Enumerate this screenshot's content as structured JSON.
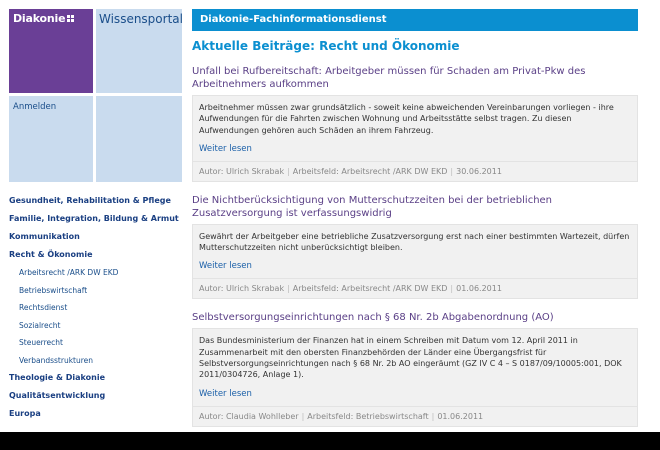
{
  "brand": {
    "name": "Diakonie",
    "portal": "Wissensportal",
    "login": "Anmelden"
  },
  "nav": {
    "items": [
      {
        "label": "Gesundheit, Rehabilitation & Pflege"
      },
      {
        "label": "Familie, Integration, Bildung & Armut"
      },
      {
        "label": "Kommunikation"
      },
      {
        "label": "Recht & Ökonomie"
      }
    ],
    "sub": [
      {
        "label": "Arbeitsrecht /ARK DW EKD"
      },
      {
        "label": "Betriebswirtschaft"
      },
      {
        "label": "Rechtsdienst"
      },
      {
        "label": "Sozialrecht"
      },
      {
        "label": "Steuerrecht"
      },
      {
        "label": "Verbandsstrukturen"
      }
    ],
    "after": [
      {
        "label": "Theologie & Diakonie"
      },
      {
        "label": "Qualitätsentwicklung"
      },
      {
        "label": "Europa"
      }
    ]
  },
  "header": {
    "title": "Diakonie-Fachinformationsdienst"
  },
  "section": {
    "prefix": "Aktuelle Beiträge: ",
    "topic": "Recht und Ökonomie"
  },
  "read_more": "Weiter lesen",
  "articles": [
    {
      "title": "Unfall bei Rufbereitschaft: Arbeitgeber müssen für Schaden am Privat-Pkw des Arbeitnehmers aufkommen",
      "body": "Arbeitnehmer müssen zwar grundsätzlich - soweit keine abweichenden Vereinbarungen vorliegen - ihre Aufwendungen für die Fahrten zwischen Wohnung und Arbeitsstätte selbst tragen. Zu diesen Aufwendungen gehören auch Schäden an ihrem Fahrzeug.",
      "author": "Autor: Ulrich Skrabak",
      "field": "Arbeitsfeld: Arbeitsrecht /ARK DW EKD",
      "date": "30.06.2011"
    },
    {
      "title": "Die Nichtberücksichtigung von Mutterschutzzeiten bei der betrieblichen Zusatzversorgung ist verfassungswidrig",
      "body": "Gewährt der Arbeitgeber eine betriebliche Zusatzversorgung erst nach einer bestimmten Wartezeit, dürfen Mutterschutzzeiten nicht unberücksichtigt bleiben.",
      "author": "Autor: Ulrich Skrabak",
      "field": "Arbeitsfeld: Arbeitsrecht /ARK DW EKD",
      "date": "01.06.2011"
    },
    {
      "title": "Selbstversorgungseinrichtungen nach § 68 Nr. 2b Abgabenordnung (AO)",
      "body": "Das Bundesministerium der Finanzen hat in einem Schreiben mit Datum vom 12. April 2011 in Zusammenarbeit mit den obersten Finanzbehörden der Länder eine Übergangsfrist für Selbstversorgungseinrichtungen nach § 68 Nr. 2b AO eingeräumt (GZ IV C 4 – S 0187/09/10005:001, DOK 2011/0304726, Anlage 1).",
      "author": "Autor: Claudia Wohlleber",
      "field": "Arbeitsfeld: Betriebswirtschaft",
      "date": "01.06.2011"
    }
  ]
}
